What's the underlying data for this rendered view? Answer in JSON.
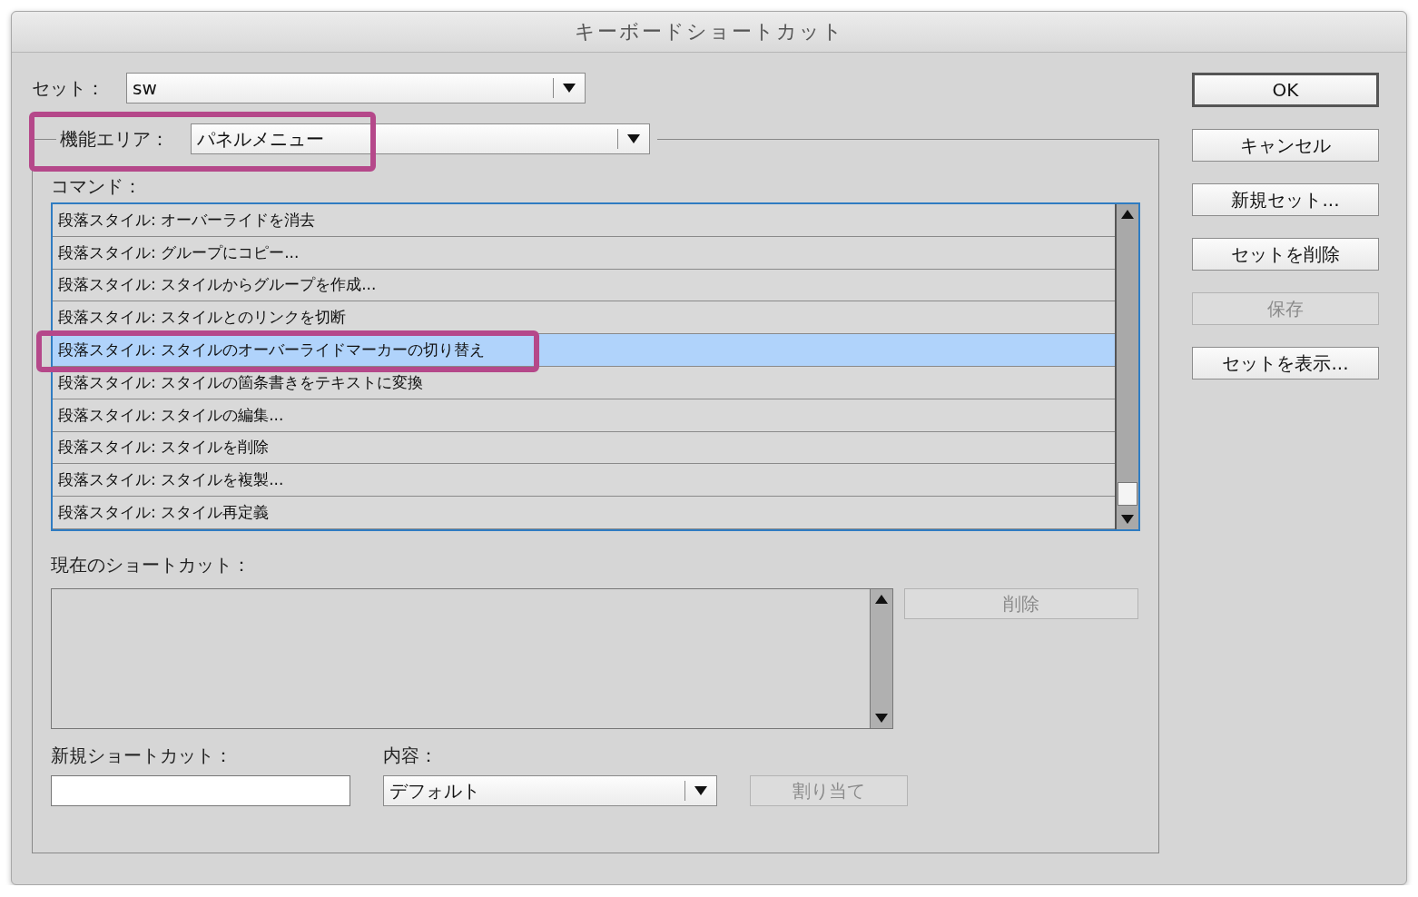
{
  "window": {
    "title": "キーボードショートカット"
  },
  "set": {
    "label": "セット：",
    "value": "sw"
  },
  "feature_area": {
    "label": "機能エリア：",
    "value": "パネルメニュー"
  },
  "commands": {
    "label": "コマンド：",
    "items": [
      {
        "label": "段落スタイル: オーバーライドを消去",
        "selected": false
      },
      {
        "label": "段落スタイル: グループにコピー...",
        "selected": false
      },
      {
        "label": "段落スタイル: スタイルからグループを作成...",
        "selected": false
      },
      {
        "label": "段落スタイル: スタイルとのリンクを切断",
        "selected": false
      },
      {
        "label": "段落スタイル: スタイルのオーバーライドマーカーの切り替え",
        "selected": true
      },
      {
        "label": "段落スタイル: スタイルの箇条書きをテキストに変換",
        "selected": false
      },
      {
        "label": "段落スタイル: スタイルの編集...",
        "selected": false
      },
      {
        "label": "段落スタイル: スタイルを削除",
        "selected": false
      },
      {
        "label": "段落スタイル: スタイルを複製...",
        "selected": false
      },
      {
        "label": "段落スタイル: スタイル再定義",
        "selected": false
      }
    ]
  },
  "current_shortcuts": {
    "label": "現在のショートカット：",
    "delete_button": {
      "label": "削除",
      "disabled": true
    }
  },
  "new_shortcut": {
    "label": "新規ショートカット："
  },
  "context": {
    "label": "内容：",
    "value": "デフォルト"
  },
  "assign_button": {
    "label": "割り当て",
    "disabled": true
  },
  "buttons": [
    {
      "label": "OK",
      "default": true,
      "disabled": false
    },
    {
      "label": "キャンセル",
      "default": false,
      "disabled": false
    },
    {
      "label": "新規セット...",
      "default": false,
      "disabled": false
    },
    {
      "label": "セットを削除",
      "default": false,
      "disabled": false
    },
    {
      "label": "保存",
      "default": false,
      "disabled": true
    },
    {
      "label": "セットを表示...",
      "default": false,
      "disabled": false
    }
  ]
}
